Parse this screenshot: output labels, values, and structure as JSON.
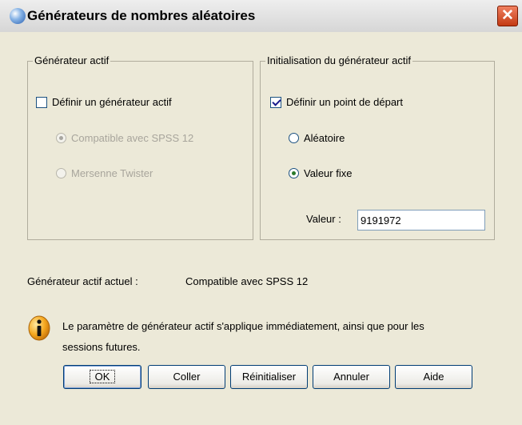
{
  "window": {
    "title": "Générateurs de nombres aléatoires",
    "close_glyph": "✕",
    "title_icon": "globe-icon"
  },
  "active_generator_group": {
    "legend": "Générateur actif",
    "set_active_checkbox": {
      "label": "Définir un générateur actif",
      "checked": false
    },
    "options": [
      {
        "label": "Compatible avec SPSS 12",
        "selected": true,
        "enabled": false
      },
      {
        "label": "Mersenne Twister",
        "selected": false,
        "enabled": false
      }
    ]
  },
  "init_group": {
    "legend": "Initialisation du générateur actif",
    "set_start_checkbox": {
      "label": "Définir un point de départ",
      "checked": true
    },
    "options": [
      {
        "label": "Aléatoire",
        "selected": false
      },
      {
        "label": "Valeur fixe",
        "selected": true
      }
    ],
    "value_label": "Valeur :",
    "value": "9191972"
  },
  "current": {
    "label": "Générateur actif actuel :",
    "value": "Compatible avec SPSS 12"
  },
  "info": {
    "icon": "info-icon",
    "line1": "Le paramètre de générateur actif s'applique immédiatement, ainsi que pour les",
    "line2": "sessions futures."
  },
  "buttons": {
    "ok": "OK",
    "paste": "Coller",
    "reset": "Réinitialiser",
    "cancel": "Annuler",
    "help": "Aide"
  }
}
